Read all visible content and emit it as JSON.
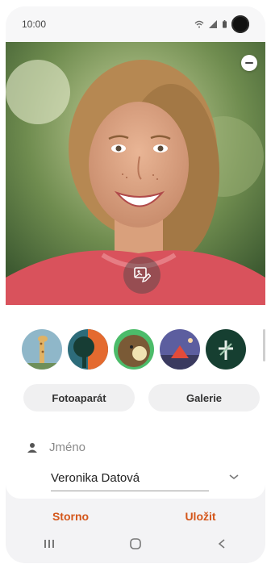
{
  "status_bar": {
    "time": "10:00",
    "icons": [
      "wifi-icon",
      "signal-icon",
      "battery-icon"
    ]
  },
  "photo": {
    "remove_icon": "minus-circle-icon",
    "edit_icon": "image-edit-icon"
  },
  "avatars": [
    {
      "name": "giraffe-avatar"
    },
    {
      "name": "tree-avatar"
    },
    {
      "name": "monkey-avatar"
    },
    {
      "name": "tent-avatar"
    },
    {
      "name": "plant-avatar"
    }
  ],
  "buttons": {
    "camera": "Fotoaparát",
    "gallery": "Galerie"
  },
  "name_field": {
    "label": "Jméno",
    "value": "Veronika Datová"
  },
  "actions": {
    "cancel": "Storno",
    "save": "Uložit"
  },
  "colors": {
    "accent": "#d4561a"
  },
  "nav": [
    "recents-icon",
    "home-icon",
    "back-icon"
  ]
}
